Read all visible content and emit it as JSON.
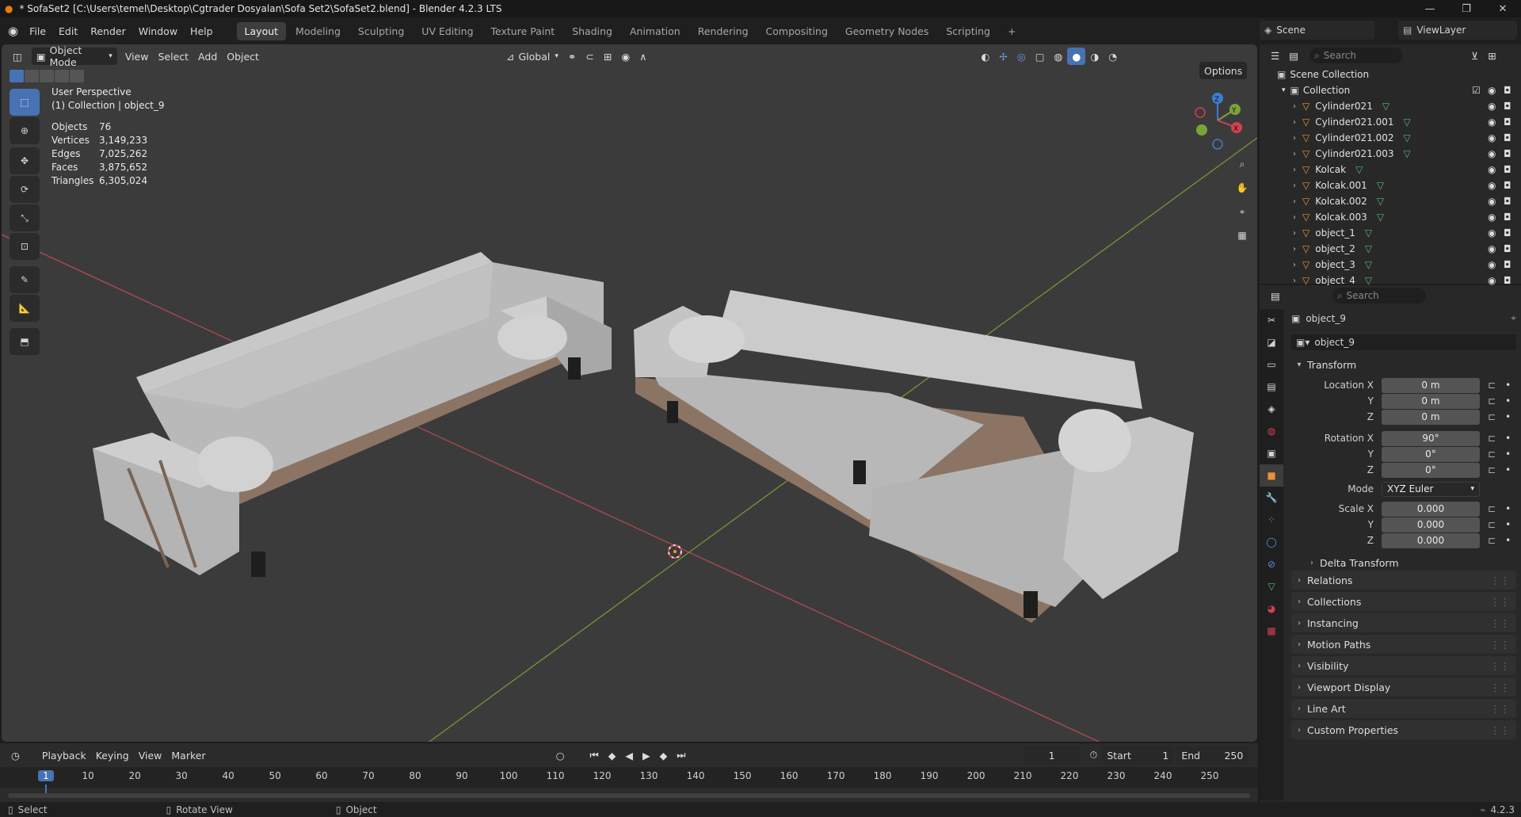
{
  "window": {
    "title": "* SofaSet2 [C:\\Users\\temel\\Desktop\\Cgtrader Dosyalan\\Sofa Set2\\SofaSet2.blend] - Blender 4.2.3 LTS"
  },
  "menu": {
    "items": [
      "File",
      "Edit",
      "Render",
      "Window",
      "Help"
    ]
  },
  "workspaces": [
    "Layout",
    "Modeling",
    "Sculpting",
    "UV Editing",
    "Texture Paint",
    "Shading",
    "Animation",
    "Rendering",
    "Compositing",
    "Geometry Nodes",
    "Scripting"
  ],
  "scene": {
    "scene_name": "Scene",
    "view_layer": "ViewLayer"
  },
  "viewport": {
    "mode": "Object Mode",
    "menus": [
      "View",
      "Select",
      "Add",
      "Object"
    ],
    "orientation": "Global",
    "options_label": "Options",
    "view_name": "User Perspective",
    "collection_line": "(1) Collection | object_9",
    "stats": [
      {
        "label": "Objects",
        "value": "76"
      },
      {
        "label": "Vertices",
        "value": "3,149,233"
      },
      {
        "label": "Edges",
        "value": "7,025,262"
      },
      {
        "label": "Faces",
        "value": "3,875,652"
      },
      {
        "label": "Triangles",
        "value": "6,305,024"
      }
    ],
    "gizmo": {
      "x": "X",
      "y": "Y",
      "z": "Z"
    },
    "colors": {
      "x_axis": "#d44050",
      "y_axis": "#7aa33a",
      "z_axis": "#3a7ed1",
      "selected": "#4772b3"
    }
  },
  "timeline": {
    "menus": [
      "Playback",
      "Keying",
      "View",
      "Marker"
    ],
    "current_frame": "1",
    "start_label": "Start",
    "start": "1",
    "end_label": "End",
    "end": "250",
    "ticks": [
      "1",
      "10",
      "20",
      "30",
      "40",
      "50",
      "60",
      "70",
      "80",
      "90",
      "100",
      "110",
      "120",
      "130",
      "140",
      "150",
      "160",
      "170",
      "180",
      "190",
      "200",
      "210",
      "220",
      "230",
      "240",
      "250"
    ]
  },
  "outliner": {
    "search_placeholder": "Search",
    "root": "Scene Collection",
    "collection": "Collection",
    "items": [
      "Cylinder021",
      "Cylinder021.001",
      "Cylinder021.002",
      "Cylinder021.003",
      "Kolcak",
      "Kolcak.001",
      "Kolcak.002",
      "Kolcak.003",
      "object_1",
      "object_2",
      "object_3",
      "object_4"
    ]
  },
  "properties": {
    "search_placeholder": "Search",
    "object_name": "object_9",
    "object_field": "object_9",
    "transform_label": "Transform",
    "location": {
      "label_x": "Location X",
      "x": "0 m",
      "y": "0 m",
      "z": "0 m"
    },
    "rotation": {
      "label_x": "Rotation X",
      "x": "90°",
      "y": "0°",
      "z": "0°"
    },
    "mode": {
      "label": "Mode",
      "value": "XYZ Euler"
    },
    "scale": {
      "label_x": "Scale X",
      "x": "0.000",
      "y": "0.000",
      "z": "0.000"
    },
    "axis_y": "Y",
    "axis_z": "Z",
    "delta_transform": "Delta Transform",
    "panels": [
      "Relations",
      "Collections",
      "Instancing",
      "Motion Paths",
      "Visibility",
      "Viewport Display",
      "Line Art",
      "Custom Properties"
    ]
  },
  "status": {
    "select": "Select",
    "rotate": "Rotate View",
    "object": "Object",
    "version": "4.2.3"
  }
}
